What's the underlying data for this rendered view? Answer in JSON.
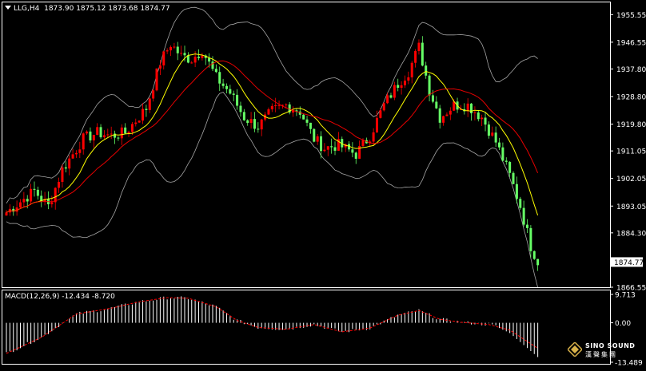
{
  "window": {
    "symbol": "LLG,H4",
    "ohlc": [
      "1873.90",
      "1875.12",
      "1873.68",
      "1874.77"
    ],
    "current_price": "1874.77"
  },
  "price_axis": {
    "ticks": [
      "1955.55",
      "1946.55",
      "1937.80",
      "1928.80",
      "1919.80",
      "1911.05",
      "1902.05",
      "1893.05",
      "1884.30",
      "1874.77",
      "1866.55"
    ]
  },
  "indicator": {
    "label": "MACD(12,26,9)",
    "values": [
      "-12.434",
      "-8.720"
    ],
    "axis_ticks": [
      "9.713",
      "0.00",
      "-13.489"
    ]
  },
  "watermark": {
    "brand": "SINO SOUND",
    "cjk": "漢聲集團"
  },
  "colors": {
    "background": "#000000",
    "bull_candle": "#66ff66",
    "bear_candle": "#ff0000",
    "ma_fast": "#ffff00",
    "ma_slow": "#ff0000",
    "bands": "#cfcfcf",
    "macd_hist": "#ffffff",
    "macd_signal": "#ff0000",
    "axis_text": "#ffffff"
  },
  "chart_data": {
    "type": "candlestick",
    "timeframe": "H4",
    "indicators": [
      "Bollinger Bands",
      "Moving Average",
      "MACD(12,26,9)"
    ],
    "price_ylim": [
      1866.55,
      1958.5
    ],
    "macd_ylim": [
      -13.489,
      9.713
    ],
    "close_keypoints": [
      [
        0,
        1891
      ],
      [
        8,
        1898
      ],
      [
        12,
        1893
      ],
      [
        16,
        1905
      ],
      [
        22,
        1915
      ],
      [
        26,
        1917
      ],
      [
        30,
        1916
      ],
      [
        34,
        1917
      ],
      [
        40,
        1925
      ],
      [
        44,
        1940
      ],
      [
        47,
        1946
      ],
      [
        50,
        1942
      ],
      [
        53,
        1941
      ],
      [
        56,
        1944
      ],
      [
        60,
        1935
      ],
      [
        64,
        1930
      ],
      [
        68,
        1922
      ],
      [
        72,
        1919
      ],
      [
        76,
        1924
      ],
      [
        80,
        1926
      ],
      [
        84,
        1924
      ],
      [
        88,
        1915
      ],
      [
        91,
        1912
      ],
      [
        95,
        1913
      ],
      [
        100,
        1910
      ],
      [
        104,
        1916
      ],
      [
        108,
        1926
      ],
      [
        112,
        1933
      ],
      [
        115,
        1937
      ],
      [
        118,
        1945
      ],
      [
        121,
        1931
      ],
      [
        124,
        1922
      ],
      [
        128,
        1926
      ],
      [
        132,
        1926
      ],
      [
        136,
        1922
      ],
      [
        140,
        1914
      ],
      [
        144,
        1903
      ],
      [
        147,
        1893
      ],
      [
        150,
        1880
      ],
      [
        152,
        1875
      ]
    ],
    "macd_signal_keypoints": [
      [
        0,
        -10.5
      ],
      [
        10,
        -5
      ],
      [
        20,
        3
      ],
      [
        30,
        5
      ],
      [
        38,
        7.2
      ],
      [
        46,
        8.6
      ],
      [
        52,
        8.4
      ],
      [
        60,
        5.5
      ],
      [
        66,
        0.8
      ],
      [
        72,
        -1.6
      ],
      [
        80,
        -2.2
      ],
      [
        88,
        -0.6
      ],
      [
        96,
        -3.1
      ],
      [
        104,
        -1.8
      ],
      [
        112,
        2.6
      ],
      [
        118,
        4.2
      ],
      [
        124,
        1.2
      ],
      [
        130,
        0.2
      ],
      [
        138,
        -0.6
      ],
      [
        144,
        -2.5
      ],
      [
        152,
        -8.72
      ]
    ]
  }
}
